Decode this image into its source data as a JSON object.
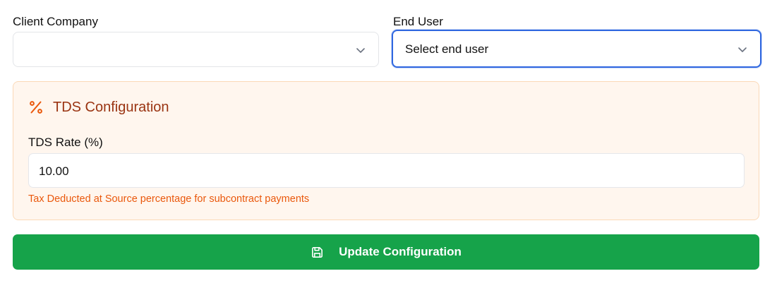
{
  "client_company": {
    "label": "Client Company",
    "value": ""
  },
  "end_user": {
    "label": "End User",
    "placeholder": "Select end user"
  },
  "tds_config": {
    "title": "TDS Configuration",
    "icon": "percent-icon",
    "rate_label": "TDS Rate (%)",
    "rate_value": "10.00",
    "help_text": "Tax Deducted at Source percentage for subcontract payments"
  },
  "actions": {
    "update_label": "Update Configuration",
    "update_icon": "save-icon"
  },
  "colors": {
    "accent_focus": "#2f67e0",
    "panel_bg": "#fff6ee",
    "panel_border": "#fbd9b7",
    "panel_title": "#9a3412",
    "help_text": "#ea580c",
    "button_bg": "#16a34a"
  }
}
